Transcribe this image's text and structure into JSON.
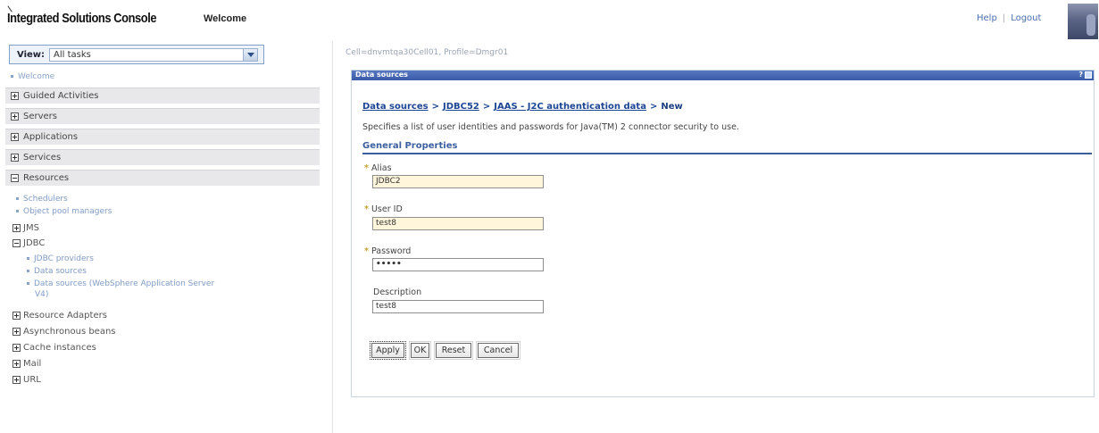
{
  "header": {
    "app_title": "Integrated Solutions Console",
    "welcome": "Welcome",
    "help": "Help",
    "separator": "|",
    "logout": "Logout"
  },
  "sidebar": {
    "view_label": "View:",
    "view_value": "All tasks",
    "welcome_link": "Welcome",
    "sections": [
      {
        "label": "Guided Activities",
        "expanded": false
      },
      {
        "label": "Servers",
        "expanded": false
      },
      {
        "label": "Applications",
        "expanded": false
      },
      {
        "label": "Services",
        "expanded": false
      },
      {
        "label": "Resources",
        "expanded": true
      }
    ],
    "resources": {
      "schedulers": "Schedulers",
      "object_pool_managers": "Object pool managers",
      "jms": "JMS",
      "jdbc": "JDBC",
      "jdbc_providers": "JDBC providers",
      "data_sources": "Data sources",
      "data_sources_v4_line1": "Data sources (WebSphere Application Server",
      "data_sources_v4_line2": "V4)",
      "resource_adapters": "Resource Adapters",
      "asynchronous_beans": "Asynchronous beans",
      "cache_instances": "Cache instances",
      "mail": "Mail",
      "url": "URL"
    }
  },
  "main": {
    "scope": "Cell=dnvmtqa30Cell01, Profile=Dmgr01",
    "panel_title": "Data sources",
    "panel_help": "?",
    "breadcrumb": {
      "data_sources": "Data sources",
      "jdbc": "JDBC52",
      "jaas": "JAAS - J2C authentication data",
      "current": "New",
      "arrow": ">"
    },
    "description": "Specifies a list of user identities and passwords for Java(TM) 2 connector security to use.",
    "section": "General Properties",
    "fields": {
      "alias_label": "Alias",
      "alias_value": "JDBC2",
      "userid_label": "User ID",
      "userid_value": "test8",
      "password_label": "Password",
      "password_value": "•••••",
      "description_label": "Description",
      "description_value": "test8",
      "required_marker": "*"
    },
    "buttons": {
      "apply": "Apply",
      "ok": "OK",
      "reset": "Reset",
      "cancel": "Cancel"
    }
  },
  "colors": {
    "panel_header": "#3a5aa8",
    "link": "#1c4595",
    "required_field_bg": "#fff6dc",
    "nav_row_bg": "#e8e8ea"
  }
}
